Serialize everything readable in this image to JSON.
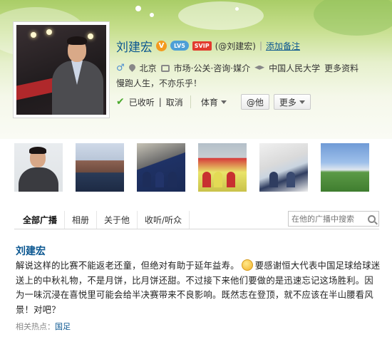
{
  "profile": {
    "name": "刘建宏",
    "verified_badge": "V",
    "level_badge": "LV5",
    "vip_badge": "SVIP",
    "handle": "(@刘建宏)",
    "remark_link": "添加备注",
    "location": "北京",
    "industry": "市场·公关·咨询·媒介",
    "school": "中国人民大学",
    "more_info": "更多资料",
    "bio": "慢跑人生，不亦乐乎！"
  },
  "actions": {
    "followed_label": "已收听",
    "cancel_label": "取消",
    "group_label": "体育",
    "at_button": "@他",
    "more_button": "更多"
  },
  "photos": {
    "items": [
      "photo-1",
      "photo-2",
      "photo-3",
      "photo-4",
      "photo-5",
      "photo-6"
    ]
  },
  "tabs": {
    "all": "全部广播",
    "album": "相册",
    "about": "关于他",
    "following": "收听/听众",
    "search_placeholder": "在他的广播中搜索"
  },
  "post": {
    "author": "刘建宏",
    "text_part1": "解说这样的比赛不能返老还童，但绝对有助于延年益寿。",
    "text_part2": "要感谢恒大代表中国足球给球迷送上的中秋礼物，不是月饼，比月饼还甜。不过接下来他们要做的是迅速忘记这场胜利。因为一味沉浸在喜悦里可能会给半决赛带来不良影响。既然志在登顶，就不应该在半山腰看风景！对吧？",
    "hot_label": "相关热点：",
    "hot_tag": "国足"
  },
  "colors": {
    "link_blue": "#0a5690",
    "banner_green": "#a9cd67",
    "check_green": "#4aa92c"
  }
}
